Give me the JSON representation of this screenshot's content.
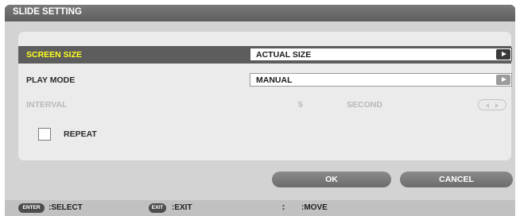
{
  "dialog": {
    "title": "SLIDE SETTING"
  },
  "settings": {
    "screen_size": {
      "label": "SCREEN SIZE",
      "value": "ACTUAL SIZE"
    },
    "play_mode": {
      "label": "PLAY MODE",
      "value": "MANUAL"
    },
    "interval": {
      "label": "INTERVAL",
      "value": "5",
      "unit": "SECOND",
      "enabled": false
    },
    "repeat": {
      "label": "REPEAT",
      "checked": false
    }
  },
  "buttons": {
    "ok": "OK",
    "cancel": "CANCEL"
  },
  "footer": {
    "select": {
      "key": "ENTER",
      "text": ":SELECT"
    },
    "exit": {
      "key": "EXIT",
      "text": ":EXIT"
    },
    "move": {
      "key": "up-down-icon",
      "text": ":MOVE"
    }
  },
  "colors": {
    "highlight_text": "#ffff1f",
    "selected_row": "#5d5d5d",
    "title_bar": "#6a6a6a"
  }
}
